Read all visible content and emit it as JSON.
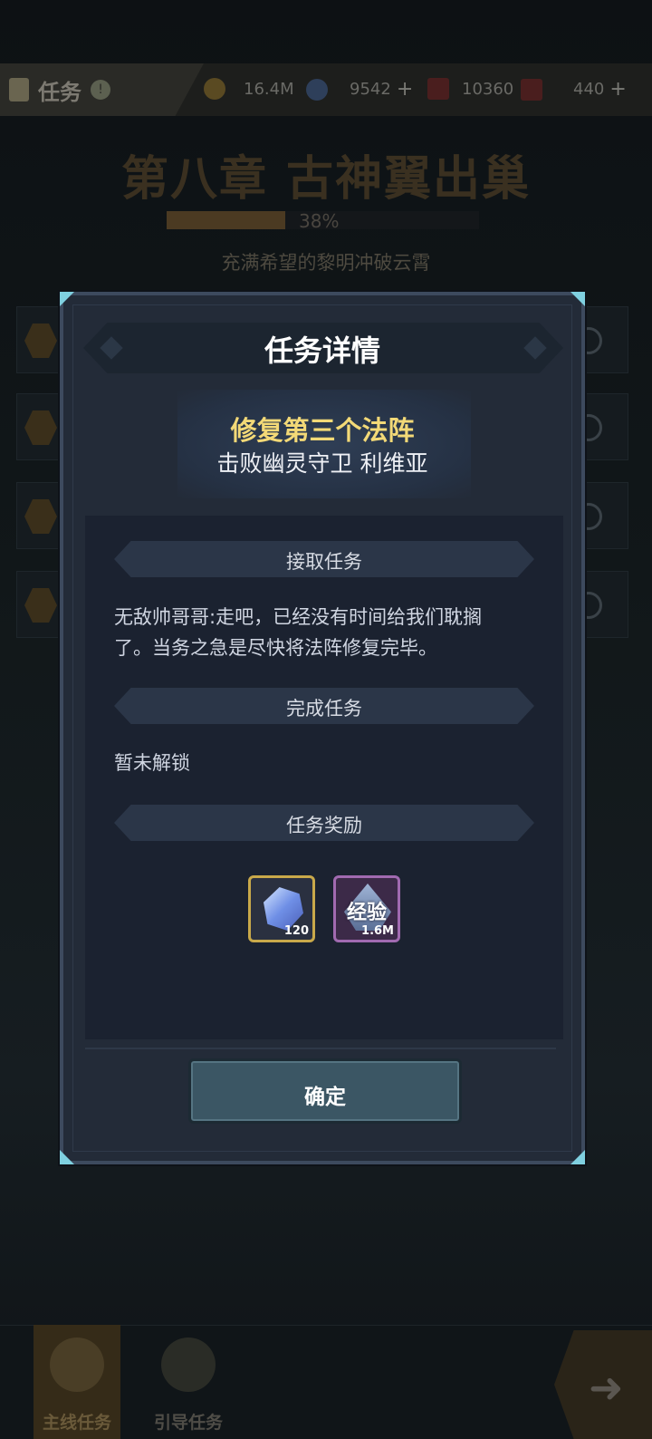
{
  "header": {
    "title": "任务",
    "resources": [
      {
        "icon": "gold-coin-icon",
        "value": "16.4M",
        "has_plus": false
      },
      {
        "icon": "crystal-icon",
        "value": "9542",
        "has_plus": true
      },
      {
        "icon": "red-ticket-icon",
        "value": "10360",
        "has_plus": false
      },
      {
        "icon": "red-card-icon",
        "value": "440",
        "has_plus": true
      }
    ]
  },
  "chapter": {
    "title": "第八章 古神翼出巢",
    "progress_percent": 38,
    "progress_label": "38%",
    "subtitle": "充满希望的黎明冲破云霄"
  },
  "dialog": {
    "title": "任务详情",
    "quest_name": "修复第三个法阵",
    "quest_target": "击败幽灵守卫 利维亚",
    "sections": {
      "accept": {
        "header": "接取任务",
        "text_line1": "无敌帅哥哥:走吧，已经没有时间给我们耽搁",
        "text_line2": "了。当务之急是尽快将法阵修复完毕。"
      },
      "complete": {
        "header": "完成任务",
        "text": "暂未解锁"
      },
      "reward": {
        "header": "任务奖励",
        "items": [
          {
            "name": "crystal",
            "icon": "crystal-icon",
            "count": "120"
          },
          {
            "name": "exp",
            "icon": "exp-icon",
            "label": "经验",
            "count": "1.6M"
          }
        ]
      }
    },
    "confirm_label": "确定"
  },
  "bottom_nav": {
    "main_quest": "主线任务",
    "guide_quest": "引导任务"
  },
  "colors": {
    "dialog_bg": "#232b38",
    "quest_name": "#f3d977",
    "button_bg": "#3b5664",
    "corner_accent": "#7fd0e0"
  }
}
